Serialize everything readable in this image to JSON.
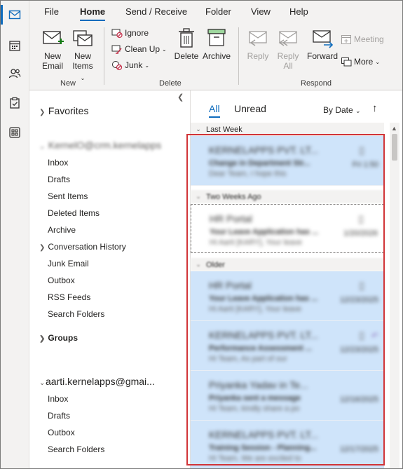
{
  "menu": {
    "tabs": [
      "File",
      "Home",
      "Send / Receive",
      "Folder",
      "View",
      "Help"
    ]
  },
  "ribbon": {
    "new_email_l1": "New",
    "new_email_l2": "Email",
    "new_items_l1": "New",
    "new_items_l2": "Items",
    "ignore": "Ignore",
    "clean_up": "Clean Up",
    "junk": "Junk",
    "delete": "Delete",
    "archive": "Archive",
    "reply": "Reply",
    "reply_all_l1": "Reply",
    "reply_all_l2": "All",
    "forward": "Forward",
    "meeting": "Meeting",
    "more": "More",
    "groups": {
      "new": "New",
      "delete": "Delete",
      "respond": "Respond"
    }
  },
  "folders": {
    "favorites": "Favorites",
    "account1": "KernelO@crm.kernelapps",
    "account1_items": [
      "Inbox",
      "Drafts",
      "Sent Items",
      "Deleted Items",
      "Archive",
      "Conversation History",
      "Junk Email",
      "Outbox",
      "RSS Feeds",
      "Search Folders"
    ],
    "groups": "Groups",
    "account2": "aarti.kernelapps@gmai...",
    "account2_items": [
      "Inbox",
      "Drafts",
      "Outbox",
      "Search Folders"
    ]
  },
  "list": {
    "tab_all": "All",
    "tab_unread": "Unread",
    "sort": "By Date",
    "groups": {
      "last_week": "Last Week",
      "two_weeks": "Two Weeks Ago",
      "older": "Older"
    },
    "messages": [
      {
        "sender": "KERNELAPPS PVT. LT...",
        "subject": "Change in Department Str...",
        "preview": "Dear Team,  I hope this",
        "date": "Fri 1:50"
      },
      {
        "sender": "HR Portal",
        "subject": "Your Leave Application has ...",
        "preview": "Hi Aarti [KARY],  Your leave",
        "date": "1/20/2026"
      },
      {
        "sender": "HR Portal",
        "subject": "Your Leave Application has ...",
        "preview": "Hi Aarti [KARY],  Your leave",
        "date": "12/23/2025"
      },
      {
        "sender": "KERNELAPPS PVT. LT...",
        "subject": "Performance Assessment ...",
        "preview": "Hi Team,  As part of our",
        "date": "12/23/2025"
      },
      {
        "sender": "Priyanka Yadav in Te...",
        "subject": "Priyanka sent a message",
        "preview": "Hi Team, kindly share a po",
        "date": "12/16/2025"
      },
      {
        "sender": "KERNELAPPS PVT. LT...",
        "subject": "Training Session - Planning...",
        "preview": "Hi Team,  We are excited to",
        "date": "12/17/2025"
      }
    ]
  },
  "colors": {
    "accent": "#0f6cbd",
    "selected": "#cfe4fa",
    "highlight": "#d13438"
  }
}
